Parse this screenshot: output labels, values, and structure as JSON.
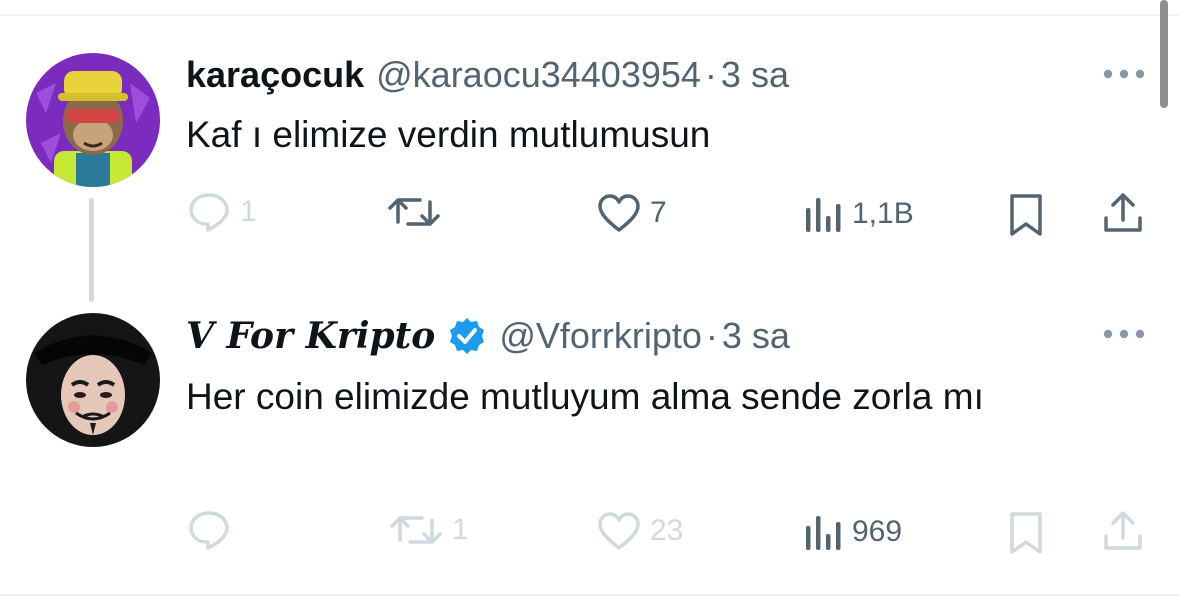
{
  "tweets": [
    {
      "name": "karaçocuk",
      "handle": "@karaocu34403954",
      "separator": "·",
      "time": "3 sa",
      "text": "Kaf ı elimize verdin mutlumusun",
      "verified": false,
      "avatar_icon": "cartoon-ape-avatar",
      "stats": {
        "replies": "1",
        "retweets": "",
        "likes": "7",
        "views": "1,1B"
      },
      "state": "dark"
    },
    {
      "name": "V For Kripto",
      "handle": "@Vforrkripto",
      "separator": "·",
      "time": "3 sa",
      "text": "Her coin elimizde mutluyum alma sende zorla mı",
      "verified": true,
      "avatar_icon": "guy-fawkes-mask-avatar",
      "stats": {
        "replies": "",
        "retweets": "1",
        "likes": "23",
        "views": "969"
      },
      "state": "faded"
    }
  ],
  "colors": {
    "text": "#0f1419",
    "secondary": "#536471",
    "faded": "#cfd9de",
    "verified_badge": "#1d9bf0",
    "divider": "#eff3f4",
    "thread_line": "#cfd9de"
  }
}
